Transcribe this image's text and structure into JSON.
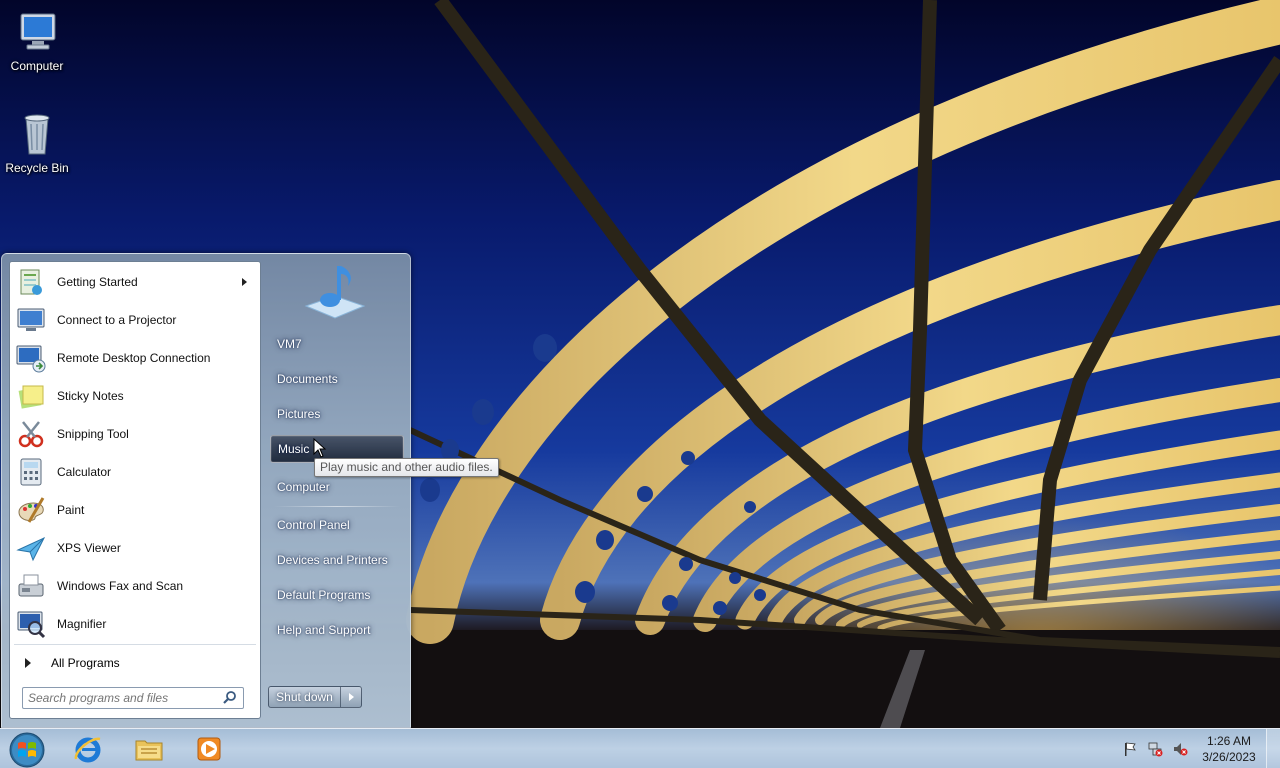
{
  "desktop": {
    "icons": [
      {
        "label": "Computer",
        "icon": "computer-icon"
      },
      {
        "label": "Recycle Bin",
        "icon": "recycle-bin-icon"
      }
    ]
  },
  "start_menu": {
    "programs": [
      {
        "label": "Getting Started",
        "icon": "getting-started-icon",
        "has_submenu": true
      },
      {
        "label": "Connect to a Projector",
        "icon": "projector-icon"
      },
      {
        "label": "Remote Desktop Connection",
        "icon": "remote-desktop-icon"
      },
      {
        "label": "Sticky Notes",
        "icon": "sticky-notes-icon"
      },
      {
        "label": "Snipping Tool",
        "icon": "snipping-tool-icon"
      },
      {
        "label": "Calculator",
        "icon": "calculator-icon"
      },
      {
        "label": "Paint",
        "icon": "paint-icon"
      },
      {
        "label": "XPS Viewer",
        "icon": "xps-viewer-icon"
      },
      {
        "label": "Windows Fax and Scan",
        "icon": "fax-scan-icon"
      },
      {
        "label": "Magnifier",
        "icon": "magnifier-icon"
      }
    ],
    "all_programs": "All Programs",
    "search_placeholder": "Search programs and files",
    "places": [
      {
        "label": "VM7"
      },
      {
        "label": "Documents"
      },
      {
        "label": "Pictures"
      },
      {
        "label": "Music",
        "hovered": true
      },
      {
        "label": "Computer"
      },
      {
        "label": "Control Panel"
      },
      {
        "label": "Devices and Printers"
      },
      {
        "label": "Default Programs"
      },
      {
        "label": "Help and Support"
      }
    ],
    "shutdown_label": "Shut down",
    "tooltip": "Play music and other audio files."
  },
  "taskbar": {
    "pinned": [
      {
        "name": "internet-explorer-icon"
      },
      {
        "name": "windows-explorer-icon"
      },
      {
        "name": "media-player-icon"
      }
    ],
    "tray": [
      "action-center-flag-icon",
      "network-icon",
      "volume-muted-icon"
    ],
    "clock_time": "1:26 AM",
    "clock_date": "3/26/2023"
  }
}
